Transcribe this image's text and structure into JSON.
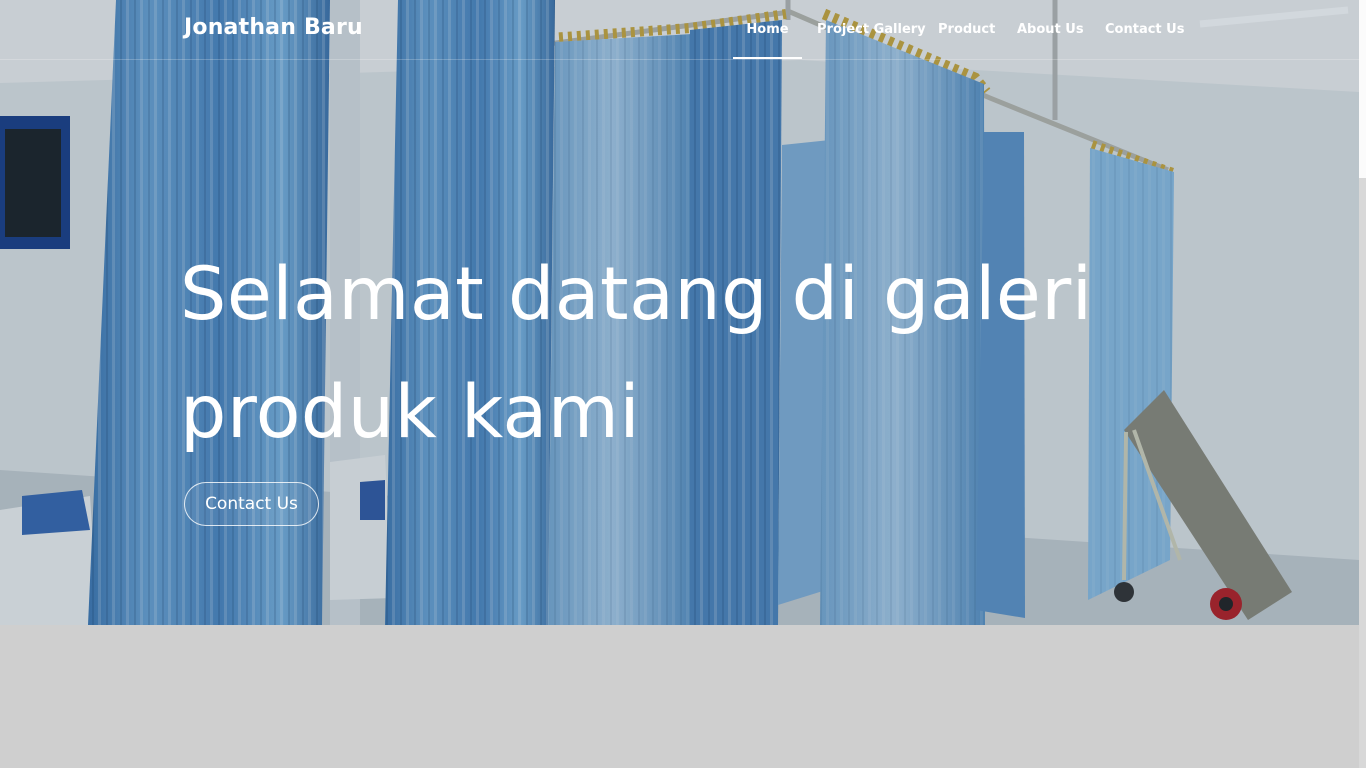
{
  "navbar": {
    "brand": "Jonathan Baru",
    "links": [
      {
        "label": "Home",
        "active": true
      },
      {
        "label": "Project Gallery",
        "active": false
      },
      {
        "label": "Product",
        "active": false
      },
      {
        "label": "About Us",
        "active": false
      },
      {
        "label": "Contact Us",
        "active": false
      }
    ]
  },
  "hero": {
    "title_line_1": "Selamat datang di galeri",
    "title_line_2": "produk kami",
    "cta_label": "Contact Us"
  },
  "colors": {
    "curtain": "#6aa2d2",
    "curtain_dark": "#4a7fae",
    "wall": "#e4e8ea",
    "rail_hook": "#c6a632"
  }
}
